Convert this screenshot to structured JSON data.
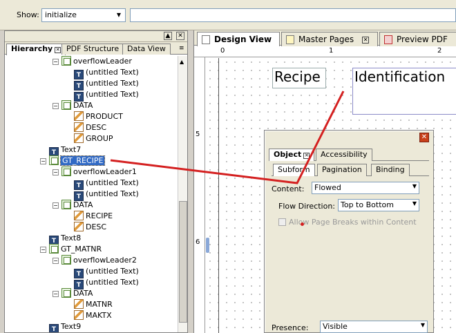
{
  "toolbar": {
    "show_label": "Show:",
    "show_value": "initialize"
  },
  "left_panel": {
    "tabs": [
      "Hierarchy",
      "PDF Structure",
      "Data View"
    ]
  },
  "tree": [
    {
      "label": "overflowLeader",
      "icon": "subform"
    },
    {
      "label": "(untitled Text)",
      "icon": "text"
    },
    {
      "label": "(untitled Text)",
      "icon": "text"
    },
    {
      "label": "(untitled Text)",
      "icon": "text"
    },
    {
      "label": "DATA",
      "icon": "subform"
    },
    {
      "label": "PRODUCT",
      "icon": "field"
    },
    {
      "label": "DESC",
      "icon": "field"
    },
    {
      "label": "GROUP",
      "icon": "field"
    },
    {
      "label": "Text7",
      "icon": "text"
    },
    {
      "label": "GT_RECIPE",
      "icon": "subform"
    },
    {
      "label": "overflowLeader1",
      "icon": "subform"
    },
    {
      "label": "(untitled Text)",
      "icon": "text"
    },
    {
      "label": "(untitled Text)",
      "icon": "text"
    },
    {
      "label": "DATA",
      "icon": "subform"
    },
    {
      "label": "RECIPE",
      "icon": "field"
    },
    {
      "label": "DESC",
      "icon": "field"
    },
    {
      "label": "Text8",
      "icon": "text"
    },
    {
      "label": "GT_MATNR",
      "icon": "subform"
    },
    {
      "label": "overflowLeader2",
      "icon": "subform"
    },
    {
      "label": "(untitled Text)",
      "icon": "text"
    },
    {
      "label": "(untitled Text)",
      "icon": "text"
    },
    {
      "label": "DATA",
      "icon": "subform"
    },
    {
      "label": "MATNR",
      "icon": "field"
    },
    {
      "label": "MAKTX",
      "icon": "field"
    },
    {
      "label": "Text9",
      "icon": "text"
    }
  ],
  "doc_tabs": [
    "Design View",
    "Master Pages",
    "Preview PDF"
  ],
  "ruler": {
    "h": [
      "0",
      "1",
      "2"
    ],
    "v": [
      "5",
      "6"
    ]
  },
  "canvas": {
    "recipe_label": "Recipe",
    "identification_label": "Identification"
  },
  "object_palette": {
    "tabs": [
      "Object",
      "Accessibility"
    ],
    "subtabs": [
      "Subform",
      "Pagination",
      "Binding"
    ],
    "content_label": "Content:",
    "content_value": "Flowed",
    "flow_label": "Flow Direction:",
    "flow_value": "Top to Bottom",
    "page_breaks_label": "Allow Page Breaks within Content",
    "presence_label": "Presence:",
    "presence_value": "Visible"
  },
  "annotation_color": "#d42020"
}
